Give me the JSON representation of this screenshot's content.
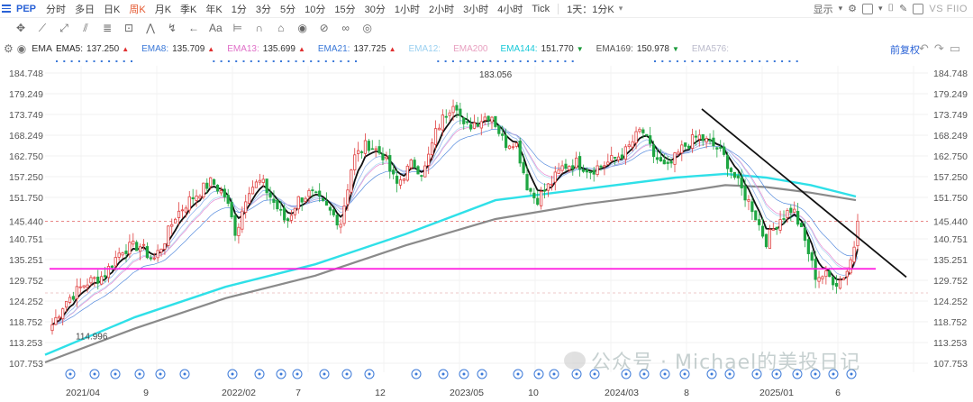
{
  "toolbar": {
    "symbol": "PEP",
    "timeframes": [
      "分时",
      "多日",
      "日K",
      "周K",
      "月K",
      "季K",
      "年K",
      "1分",
      "3分",
      "5分",
      "10分",
      "15分",
      "30分",
      "1小时",
      "2小时",
      "3小时",
      "4小时",
      "Tick"
    ],
    "active_timeframe": "周K",
    "interval_select": "1天：1分K",
    "display_menu": "显示",
    "compare_label": "VS FIIO"
  },
  "indicator_bar": {
    "main_indicator": "EMA",
    "fuquan": "前复权",
    "emas": [
      {
        "name": "EMA5:",
        "value": "137.250",
        "color": "#222222",
        "dir": "up"
      },
      {
        "name": "EMA8:",
        "value": "135.709",
        "color": "#3a78d8",
        "dir": "up"
      },
      {
        "name": "EMA13:",
        "value": "135.699",
        "color": "#e070c8",
        "dir": "up"
      },
      {
        "name": "EMA21:",
        "value": "137.725",
        "color": "#3a78d8",
        "dir": "up"
      },
      {
        "name": "EMA12:",
        "value": "",
        "color": "#9ad0f0",
        "dir": ""
      },
      {
        "name": "EMA200",
        "value": "",
        "color": "#e8a0c0",
        "dir": ""
      },
      {
        "name": "EMA144:",
        "value": "151.770",
        "color": "#16c8d8",
        "dir": "dn"
      },
      {
        "name": "EMA169:",
        "value": "150.978",
        "color": "#555555",
        "dir": "dn"
      },
      {
        "name": "EMA576:",
        "value": "",
        "color": "#bbbbcc",
        "dir": ""
      }
    ]
  },
  "chart_data": {
    "type": "candlestick",
    "y_ticks": [
      "184.748",
      "179.249",
      "173.749",
      "168.249",
      "162.750",
      "157.250",
      "151.750",
      "145.440",
      "140.751",
      "135.251",
      "129.752",
      "124.252",
      "118.752",
      "113.253",
      "107.753"
    ],
    "ylim": [
      107.753,
      184.748
    ],
    "current_price": "145.440",
    "x_ticks": [
      "2021/04",
      "9",
      "2022/02",
      "7",
      "12",
      "2023/05",
      "10",
      "2024/03",
      "8",
      "2025/01",
      "6"
    ],
    "annotations": {
      "high": "183.056",
      "low": "114.996"
    },
    "support_level": 132.8,
    "ema144_end": 151.77,
    "ema169_end": 150.978,
    "colors": {
      "up": "#e04040",
      "down": "#1fa642",
      "ema5": "#111111",
      "ema144": "#2fe0e8",
      "ema169": "#8a8a8a",
      "support": "#ff18e0",
      "trend": "#111111",
      "price_line": "#e06060"
    }
  },
  "watermark": {
    "text": "公众号 · Michael的美投日记"
  }
}
